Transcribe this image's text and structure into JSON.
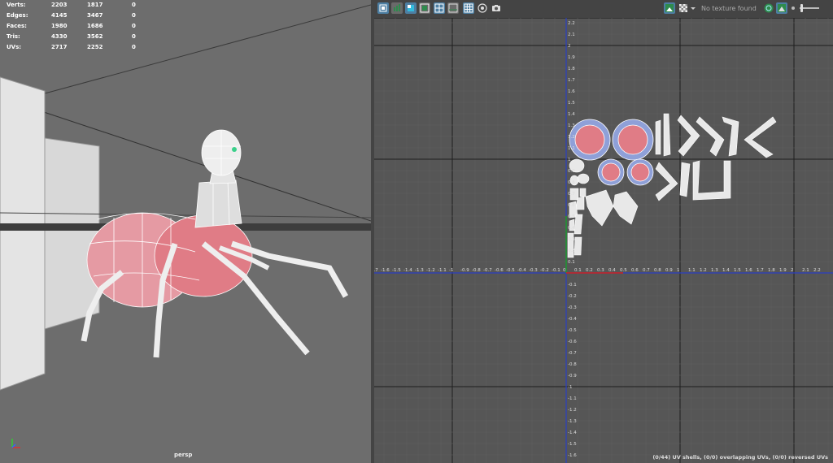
{
  "hud": {
    "rows": [
      {
        "label": "Verts:",
        "a": "2203",
        "b": "1817",
        "c": "0"
      },
      {
        "label": "Edges:",
        "a": "4145",
        "b": "3467",
        "c": "0"
      },
      {
        "label": "Faces:",
        "a": "1980",
        "b": "1686",
        "c": "0"
      },
      {
        "label": "Tris:",
        "a": "4330",
        "b": "3562",
        "c": "0"
      },
      {
        "label": "UVs:",
        "a": "2717",
        "b": "2252",
        "c": "0"
      }
    ]
  },
  "viewport": {
    "camera": "persp"
  },
  "uv_editor": {
    "texture_label": "No texture found",
    "status": "(0/44) UV shells, (0/0) overlapping UVs, (0/0) reversed UVs",
    "h_ticks": [
      "-1.7",
      "-1.6",
      "-1.5",
      "-1.4",
      "-1.3",
      "-1.2",
      "-1.1",
      "-1",
      "-0.9",
      "-0.8",
      "-0.7",
      "-0.6",
      "-0.5",
      "-0.4",
      "-0.3",
      "-0.2",
      "-0.1",
      "0",
      "0.1",
      "0.2",
      "0.3",
      "0.4",
      "0.5",
      "0.6",
      "0.7",
      "0.8",
      "0.9",
      "1",
      "1.1",
      "1.2",
      "1.3",
      "1.4",
      "1.5",
      "1.6",
      "1.7",
      "1.8",
      "1.9",
      "2",
      "2.1",
      "2.2"
    ],
    "v_ticks_pos": [
      "0.1",
      "0.2",
      "0.3",
      "0.4",
      "0.5",
      "0.6",
      "0.7",
      "0.8",
      "0.9",
      "1",
      "1.1",
      "1.2",
      "1.3",
      "1.4",
      "1.5",
      "1.6",
      "1.7",
      "1.8",
      "1.9",
      "2",
      "2.1",
      "2.2"
    ],
    "v_ticks_neg": [
      "-0.1",
      "-0.2",
      "-0.3",
      "-0.4",
      "-0.5",
      "-0.6",
      "-0.7",
      "-0.8",
      "-0.9",
      "-1",
      "-1.1",
      "-1.2",
      "-1.3",
      "-1.4",
      "-1.5",
      "-1.6"
    ],
    "toolbar_icons": [
      "uv-toolkit-icon",
      "image-filter-icon",
      "shaded-uvs-icon",
      "texture-borders-icon",
      "uv-grid-icon",
      "pixel-snap-icon",
      "distortion-icon",
      "snapshot-icon"
    ],
    "right_icons": [
      "display-image-icon",
      "checker-icon",
      "dropdown-icon",
      "uv-sets-icon",
      "exposure-icon"
    ],
    "colors": {
      "grid_minor": "#5e5e5e",
      "grid_major": "#1e1e1e",
      "u_axis": "#2a3fc4",
      "v_axis": "#1e9a2a",
      "shell_fill": "#e8e8e8",
      "shell_selected": "#e07c86",
      "shell_outer": "#8fa0d8"
    }
  }
}
